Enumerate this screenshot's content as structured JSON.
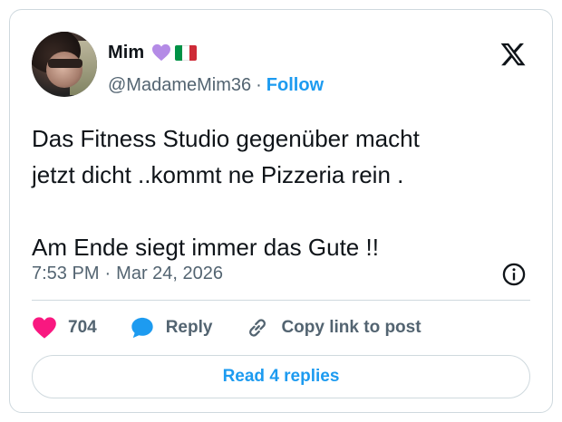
{
  "author": {
    "display_name": "Mim",
    "handle": "@MadameMim36",
    "follow_label": "Follow",
    "separator": "·"
  },
  "tweet": {
    "line1": "Das Fitness Studio gegenüber macht",
    "line2": "jetzt dicht ..kommt ne Pizzeria rein .",
    "line3": "Am Ende siegt immer das Gute !!",
    "time": "7:53 PM",
    "date": "Mar 24, 2026",
    "separator": "·"
  },
  "actions": {
    "like_count": "704",
    "reply_label": "Reply",
    "copy_link_label": "Copy link to post",
    "read_replies_label": "Read 4 replies"
  },
  "icons": {
    "logo": "x-logo-icon",
    "heart_emoji": "purple-heart-icon",
    "flag": "italy-flag-icon",
    "info": "info-icon",
    "like": "heart-icon",
    "reply": "reply-bubble-icon",
    "link": "link-icon"
  },
  "colors": {
    "accent": "#1d9bf0",
    "like": "#f91880",
    "secondary_text": "#536471",
    "border": "#cfd9de",
    "purple_heart": "#b48be6",
    "flag_green": "#009246",
    "flag_white": "#ffffff",
    "flag_red": "#ce2b37"
  }
}
